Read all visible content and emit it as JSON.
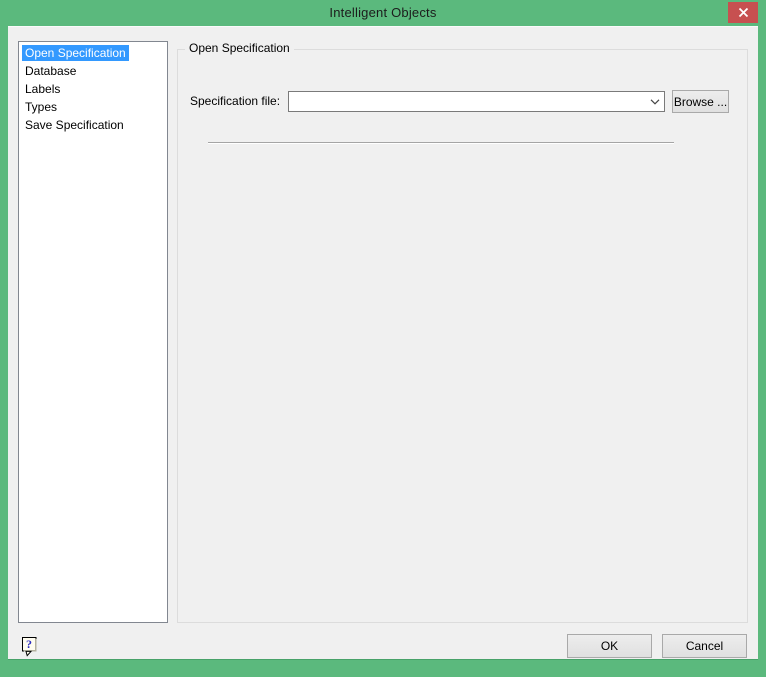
{
  "colors": {
    "accent_green": "#5bb97d",
    "close_red": "#c75050",
    "selection_blue": "#3399ff",
    "dialog_bg": "#f0f0f0"
  },
  "window": {
    "title": "Intelligent Objects",
    "close_icon": "x-close"
  },
  "sidebar": {
    "items": [
      {
        "label": "Open Specification",
        "selected": true
      },
      {
        "label": "Database",
        "selected": false
      },
      {
        "label": "Labels",
        "selected": false
      },
      {
        "label": "Types",
        "selected": false
      },
      {
        "label": "Save Specification",
        "selected": false
      }
    ]
  },
  "main": {
    "group_title": "Open Specification",
    "spec_file_label": "Specification file:",
    "spec_file_value": "",
    "combo_icon": "chevron-down",
    "browse_label": "Browse ..."
  },
  "footer": {
    "help_icon": "context-help",
    "ok_label": "OK",
    "cancel_label": "Cancel"
  }
}
